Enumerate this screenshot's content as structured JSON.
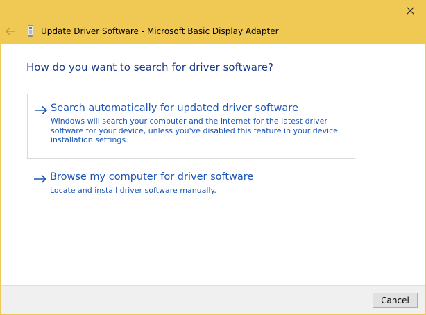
{
  "window": {
    "title": "Update Driver Software - Microsoft Basic Display Adapter",
    "title_bar_color": "#f0c955"
  },
  "titlebar": {
    "close_icon": "close-icon",
    "back_icon": "back-arrow-icon",
    "device_icon": "display-adapter-icon"
  },
  "main": {
    "question": "How do you want to search for driver software?",
    "options": [
      {
        "title": "Search automatically for updated driver software",
        "description": "Windows will search your computer and the Internet for the latest driver software for your device, unless you've disabled this feature in your device installation settings.",
        "icon": "arrow-right-icon"
      },
      {
        "title": "Browse my computer for driver software",
        "description": "Locate and install driver software manually.",
        "icon": "arrow-right-icon"
      }
    ],
    "link_color": "#1e56b5",
    "heading_color": "#1c3a8a"
  },
  "footer": {
    "cancel_label": "Cancel"
  }
}
